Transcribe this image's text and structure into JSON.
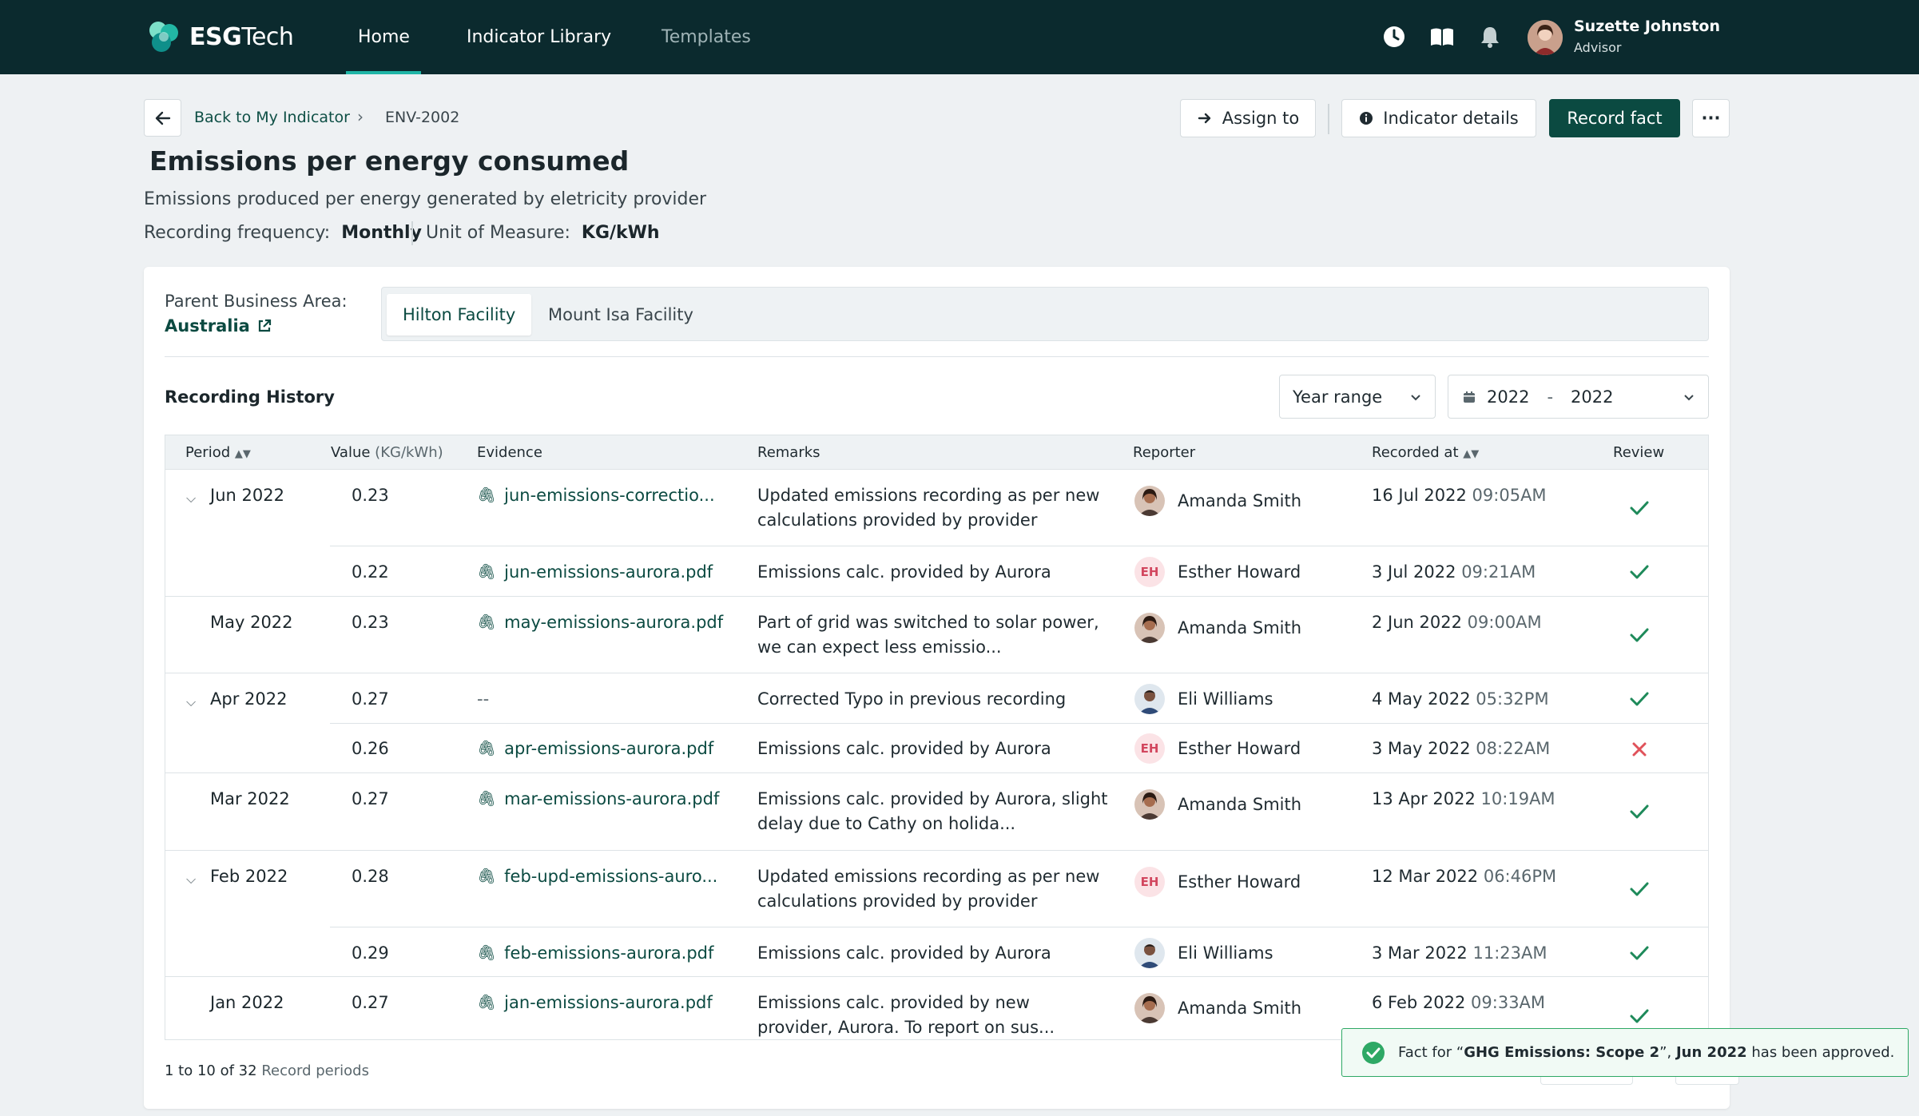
{
  "app": {
    "brand_bold": "ESG",
    "brand_light": "Tech",
    "nav": [
      {
        "label": "Home",
        "active": true
      },
      {
        "label": "Indicator Library",
        "active": false
      },
      {
        "label": "Templates",
        "active": false
      }
    ],
    "icons": [
      "clock-icon",
      "book-icon",
      "bell-icon"
    ],
    "user": {
      "name": "Suzette Johnston",
      "role": "Advisor"
    }
  },
  "breadcrumb": {
    "back_label": "Back to My Indicator",
    "current": "ENV-2002"
  },
  "actions": {
    "assign": "Assign to",
    "details": "Indicator details",
    "record": "Record fact",
    "more": "···"
  },
  "indicator": {
    "title": "Emissions per energy consumed",
    "description": "Emissions produced per energy generated by eletricity provider",
    "freq_label": "Recording frequency:",
    "freq_value": "Monthly",
    "uom_label": "Unit of Measure:",
    "uom_value": "KG/kWh"
  },
  "business_area": {
    "label": "Parent Business Area:",
    "value": "Australia"
  },
  "facility_tabs": [
    {
      "label": "Hilton Facility",
      "active": true
    },
    {
      "label": "Mount Isa Facility",
      "active": false
    }
  ],
  "history": {
    "title": "Recording History",
    "range_type": "Year range",
    "year_from": "2022",
    "year_sep": "-",
    "year_to": "2022"
  },
  "table": {
    "headers": {
      "period": "Period",
      "value": "Value",
      "value_unit": "(KG/kWh)",
      "evidence": "Evidence",
      "remarks": "Remarks",
      "reporter": "Reporter",
      "recorded_at": "Recorded at",
      "review": "Review"
    },
    "rows": [
      {
        "period": "Jun 2022",
        "value": "0.23",
        "evidence": "jun-emissions-correctio...",
        "remarks": "Updated emissions recording as per new calculations provided by provider",
        "reporter": "Amanda Smith",
        "date": "16 Jul 2022",
        "time": "09:05AM",
        "review": "approved"
      },
      {
        "period": "",
        "value": "0.22",
        "evidence": "jun-emissions-aurora.pdf",
        "remarks": "Emissions calc. provided by Aurora",
        "reporter": "Esther Howard",
        "initials": "EH",
        "date": "3 Jul 2022",
        "time": "09:21AM",
        "review": "approved"
      },
      {
        "period": "May 2022",
        "value": "0.23",
        "evidence": "may-emissions-aurora.pdf",
        "remarks": "Part of grid was switched to solar power, we can expect less emissio...",
        "reporter": "Amanda Smith",
        "date": "2 Jun 2022",
        "time": "09:00AM",
        "review": "approved"
      },
      {
        "period": "Apr 2022",
        "value": "0.27",
        "evidence": "--",
        "remarks": "Corrected Typo in previous recording",
        "reporter": "Eli Williams",
        "date": "4 May 2022",
        "time": "05:32PM",
        "review": "approved"
      },
      {
        "period": "",
        "value": "0.26",
        "evidence": "apr-emissions-aurora.pdf",
        "remarks": "Emissions calc. provided by Aurora",
        "reporter": "Esther Howard",
        "initials": "EH",
        "date": "3 May 2022",
        "time": "08:22AM",
        "review": "rejected"
      },
      {
        "period": "Mar 2022",
        "value": "0.27",
        "evidence": "mar-emissions-aurora.pdf",
        "remarks": "Emissions calc. provided by Aurora, slight delay due to Cathy on holida...",
        "reporter": "Amanda Smith",
        "date": "13 Apr 2022",
        "time": "10:19AM",
        "review": "approved"
      },
      {
        "period": "Feb 2022",
        "value": "0.28",
        "evidence": "feb-upd-emissions-auro...",
        "remarks": "Updated emissions recording as per new calculations provided by provider",
        "reporter": "Esther Howard",
        "initials": "EH",
        "date": "12 Mar 2022",
        "time": "06:46PM",
        "review": "approved"
      },
      {
        "period": "",
        "value": "0.29",
        "evidence": "feb-emissions-aurora.pdf",
        "remarks": "Emissions calc. provided by Aurora",
        "reporter": "Eli Williams",
        "date": "3 Mar 2022",
        "time": "11:23AM",
        "review": "approved"
      },
      {
        "period": "Jan 2022",
        "value": "0.27",
        "evidence": "jan-emissions-aurora.pdf",
        "remarks": "Emissions calc. provided by new provider, Aurora. To report on sus...",
        "reporter": "Amanda Smith",
        "date": "6 Feb 2022",
        "time": "09:33AM",
        "review": "approved"
      }
    ]
  },
  "pagination": {
    "range": "1 to 10 of 32",
    "suffix": "Record periods"
  },
  "toast": {
    "prefix": "Fact for “",
    "fact": "GHG Emissions: Scope 2",
    "middle": "”, ",
    "period": "Jun 2022",
    "suffix": " has been approved."
  },
  "colors": {
    "nav_bg": "#0b2a2e",
    "primary": "#0b4a41",
    "approved": "#1e8a5a",
    "rejected": "#e0525a",
    "accent": "#1fb5a6"
  }
}
